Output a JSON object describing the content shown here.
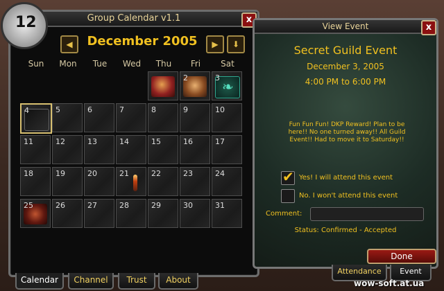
{
  "calendar": {
    "title": "Group Calendar v1.1",
    "icon_number": "12",
    "close_label": "x",
    "prev_label": "◀",
    "next_label": "▶",
    "down_label": "⬇",
    "month": "December 2005",
    "weekdays": [
      "Sun",
      "Mon",
      "Tue",
      "Wed",
      "Thu",
      "Fri",
      "Sat"
    ],
    "cells": [
      {
        "day": "",
        "event": "red-warrior-icon"
      },
      {
        "day": "2",
        "event": "orc-face-icon"
      },
      {
        "day": "3",
        "event": "green-swirl-icon"
      },
      {
        "day": "4",
        "event": "dark-square-icon"
      },
      {
        "day": "5"
      },
      {
        "day": "6"
      },
      {
        "day": "7"
      },
      {
        "day": "8"
      },
      {
        "day": "9"
      },
      {
        "day": "10"
      },
      {
        "day": "11"
      },
      {
        "day": "12"
      },
      {
        "day": "13"
      },
      {
        "day": "14"
      },
      {
        "day": "15"
      },
      {
        "day": "16"
      },
      {
        "day": "17"
      },
      {
        "day": "18"
      },
      {
        "day": "19"
      },
      {
        "day": "20"
      },
      {
        "day": "21"
      },
      {
        "day": "22"
      },
      {
        "day": "23"
      },
      {
        "day": "24"
      },
      {
        "day": "25"
      },
      {
        "day": "26"
      },
      {
        "day": "27"
      },
      {
        "day": "28"
      },
      {
        "day": "29"
      },
      {
        "day": "30"
      },
      {
        "day": "31"
      }
    ],
    "tabs": [
      "Calendar",
      "Channel",
      "Trust",
      "About"
    ]
  },
  "event": {
    "window_title": "View Event",
    "close_label": "x",
    "name": "Secret Guild Event",
    "date": "December 3, 2005",
    "time": "4:00 PM to 6:00 PM",
    "description": "Fun Fun Fun! DKP Reward! Plan to be here!! No one turned away!! All Guild Event!! Had to move it to Saturday!!",
    "attend_yes": "Yes! I will attend this event",
    "attend_no": "No. I won't attend this event",
    "attend_yes_checked": true,
    "attend_no_checked": false,
    "comment_label": "Comment:",
    "comment_value": "",
    "status": "Status: Confirmed - Accepted",
    "done_label": "Done",
    "tabs": [
      "Attendance",
      "Event"
    ]
  },
  "watermark": "wow-soft.at.ua",
  "colors": {
    "gold": "#f0c020",
    "done_red": "#9a1a14"
  }
}
